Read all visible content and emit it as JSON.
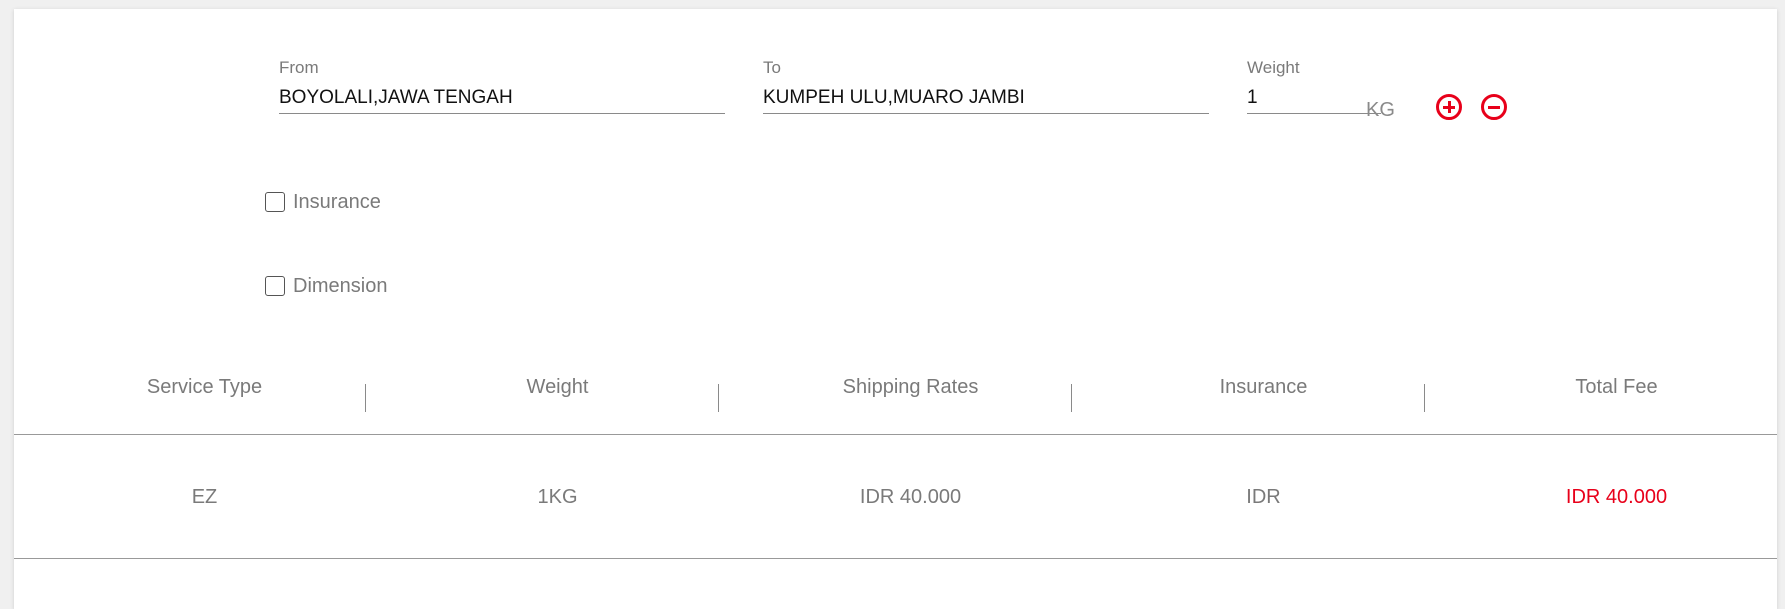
{
  "form": {
    "from": {
      "label": "From",
      "value": "BOYOLALI,JAWA TENGAH"
    },
    "to": {
      "label": "To",
      "value": "KUMPEH ULU,MUARO JAMBI"
    },
    "weight": {
      "label": "Weight",
      "value": "1",
      "unit": "KG"
    },
    "increase_icon": "plus-circle-icon",
    "decrease_icon": "minus-circle-icon",
    "insurance_label": "Insurance",
    "insurance_checked": false,
    "dimension_label": "Dimension",
    "dimension_checked": false
  },
  "table": {
    "headers": [
      "Service Type",
      "Weight",
      "Shipping Rates",
      "Insurance",
      "Total Fee"
    ],
    "rows": [
      [
        "EZ",
        "1KG",
        "IDR 40.000",
        "IDR",
        "IDR 40.000"
      ]
    ]
  },
  "colors": {
    "accent": "#e8001a",
    "muted_text": "#7a7a7a"
  }
}
